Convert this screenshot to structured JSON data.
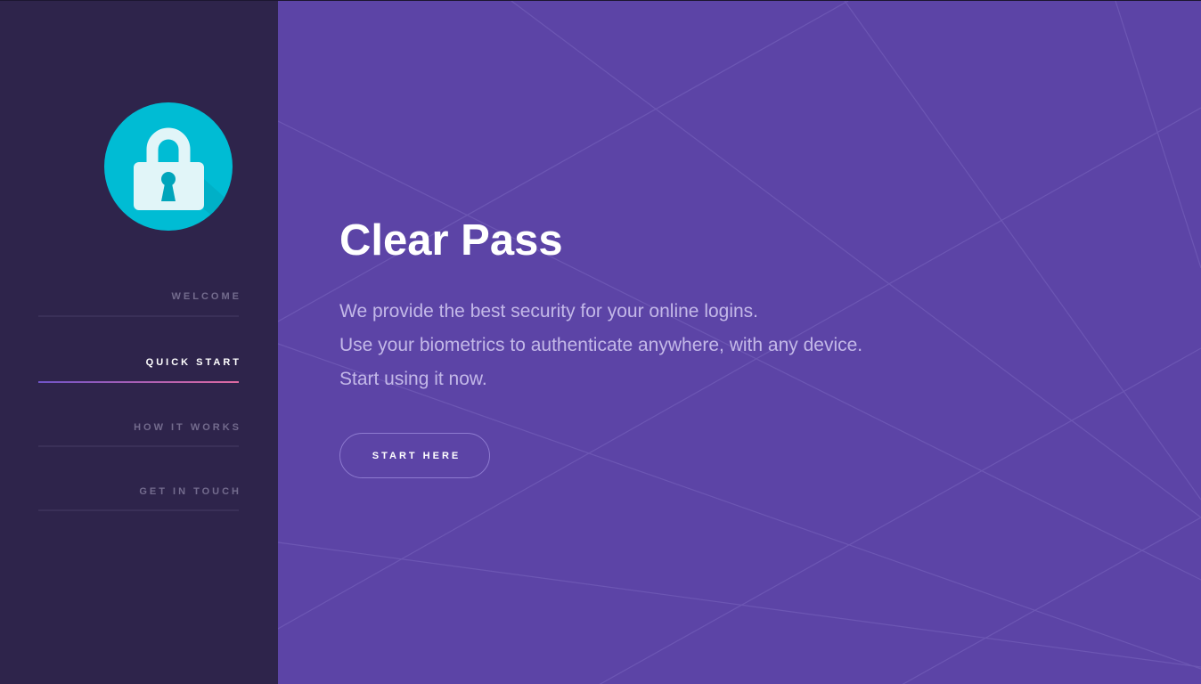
{
  "sidebar": {
    "logo_icon": "lock-icon",
    "items": [
      {
        "label": "WELCOME"
      },
      {
        "label": "QUICK START"
      },
      {
        "label": "HOW IT WORKS"
      },
      {
        "label": "GET IN TOUCH"
      }
    ],
    "active_item": "QUICK START"
  },
  "hero": {
    "title": "Clear Pass",
    "lines": [
      "We provide the best security for your online logins.",
      "Use your biometrics to authenticate anywhere, with any device.",
      "Start using it now."
    ],
    "cta_label": "START HERE"
  },
  "colors": {
    "sidebar_bg": "#2e244b",
    "main_bg": "#5c44a6",
    "logo_circle": "#00bcd4",
    "active_underline_start": "#7054c8",
    "active_underline_end": "#e06aa2"
  }
}
